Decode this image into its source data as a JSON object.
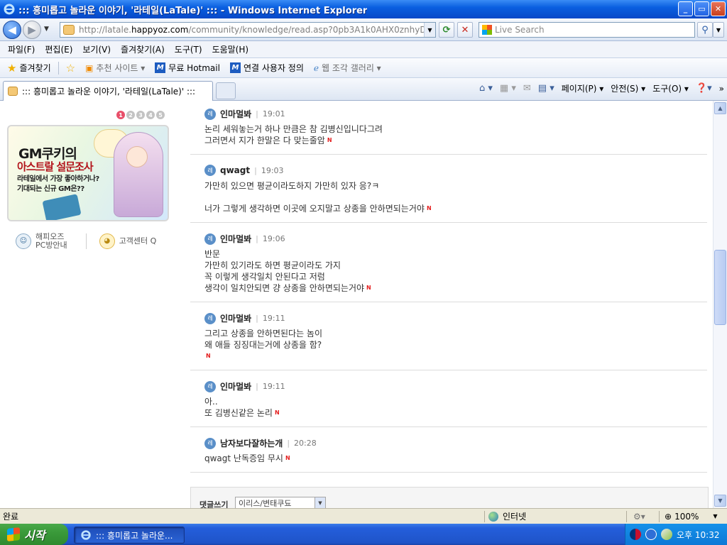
{
  "window": {
    "title": "::: 흥미롭고 놀라운 이야기, '라테일(LaTale)' ::: - Windows Internet Explorer",
    "min": "_",
    "max": "▭",
    "close": "✕"
  },
  "address": {
    "url_prefix": "http://latale.",
    "url_domain": "happyoz.com",
    "url_rest": "/community/knowledge/read.asp?0pb3A1k0AHX0znhyD2Lm",
    "search_placeholder": "Live Search"
  },
  "menu": [
    "파일(F)",
    "편집(E)",
    "보기(V)",
    "즐겨찾기(A)",
    "도구(T)",
    "도움말(H)"
  ],
  "favorites_bar": {
    "favorites": "즐겨찾기",
    "suggested": "추천 사이트 ▾",
    "hotmail": "무료 Hotmail",
    "custom": "연결 사용자 정의",
    "gallery": "웹 조각 갤러리 ▾"
  },
  "tab": {
    "label": "::: 흥미롭고 놀라운 이야기, '라테일(LaTale)' :::"
  },
  "commands": {
    "page": "페이지(P) ▾",
    "safety": "안전(S) ▾",
    "tools": "도구(O) ▾",
    "more": "»"
  },
  "sidebar": {
    "pages": [
      "1",
      "2",
      "3",
      "4",
      "5"
    ],
    "banner": {
      "line1": "GM쿠키의",
      "line2": "아스트랄 설문조사",
      "line3": "라테일에서 가장 좋아하거나?",
      "line4": "기대되는 신규 GM은??"
    },
    "link1_top": "해피오즈",
    "link1_bottom": "PC방안내",
    "link2": "고객센터 Q"
  },
  "comments": [
    {
      "level": "레",
      "name": "인마멀봐",
      "time": "19:01",
      "lines": [
        "논리 세워놓는거 하나 만큼은 참 김병신입니다그려",
        "그러면서 지가 한말은 다 맞는줄암"
      ]
    },
    {
      "level": "레",
      "name": "qwagt",
      "time": "19:03",
      "lines": [
        "가만히 있으면 평균이라도하지 가만히 있자 응?ㅋ",
        "",
        "너가 그렇게 생각하면 이곳에 오지말고 상종을 안하면되는거야"
      ]
    },
    {
      "level": "레",
      "name": "인마멀봐",
      "time": "19:06",
      "lines": [
        "반문",
        "가만히 있기라도 하면 평균이라도 가지",
        "꼭 이렇게 생각일치 안된다고 저럼",
        "생각이 일치안되면 걍 상종을 안하면되는거야"
      ]
    },
    {
      "level": "레",
      "name": "인마멀봐",
      "time": "19:11",
      "lines": [
        "그리고 상종을 안하면된다는 놈이",
        "왜 애들 징징대는거에 상종을 함?",
        ""
      ]
    },
    {
      "level": "레",
      "name": "인마멀봐",
      "time": "19:11",
      "lines": [
        "아..",
        "또 김병신같은 논리"
      ]
    },
    {
      "level": "레",
      "name": "남자보다잘하는개",
      "time": "20:28",
      "lines": [
        "qwagt 난독증임 무시"
      ]
    }
  ],
  "new_mark": "N",
  "write": {
    "label": "댓글쓰기",
    "select_value": "이리스/변태쿠됴"
  },
  "status": {
    "left": "완료",
    "zone": "인터넷",
    "zoom": "100%"
  },
  "taskbar": {
    "start": "시작",
    "task": "::: 흥미롭고 놀라운...",
    "clock": "오후 10:32"
  }
}
